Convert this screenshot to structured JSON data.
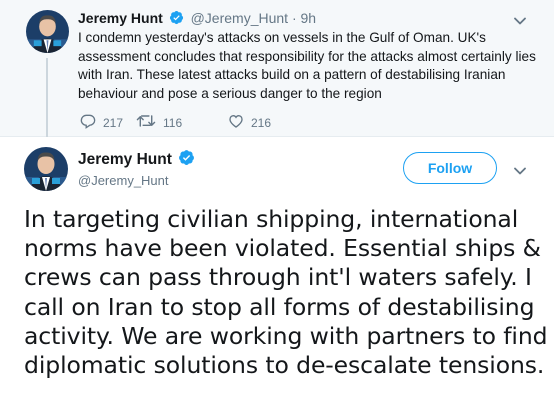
{
  "parent_tweet": {
    "author_name": "Jeremy Hunt",
    "handle": "@Jeremy_Hunt",
    "dot": "·",
    "time": "9h",
    "text": "I condemn yesterday's attacks on vessels in the Gulf of Oman. UK's assessment concludes that responsibility for the attacks almost certainly lies with Iran. These latest attacks build on a pattern of destabilising Iranian behaviour and pose a serious danger to the region",
    "reply_count": "217",
    "retweet_count": "116",
    "like_count": "216",
    "icons": [
      "avatar",
      "verified-badge-icon",
      "chevron-down-icon",
      "reply-icon",
      "retweet-icon",
      "heart-icon"
    ]
  },
  "main_tweet": {
    "author_name": "Jeremy Hunt",
    "handle": "@Jeremy_Hunt",
    "follow_label": "Follow",
    "text": "In targeting civilian shipping, international norms have been violated. Essential ships & crews can pass through int'l waters safely. I call on Iran to stop all forms of destabilising activity. We are working with partners to find diplomatic solutions to de-escalate tensions."
  },
  "colors": {
    "accent": "#1da1f2",
    "parent_background": "#f5f8fa",
    "secondary_text": "#657786",
    "primary_text": "#14171a"
  }
}
